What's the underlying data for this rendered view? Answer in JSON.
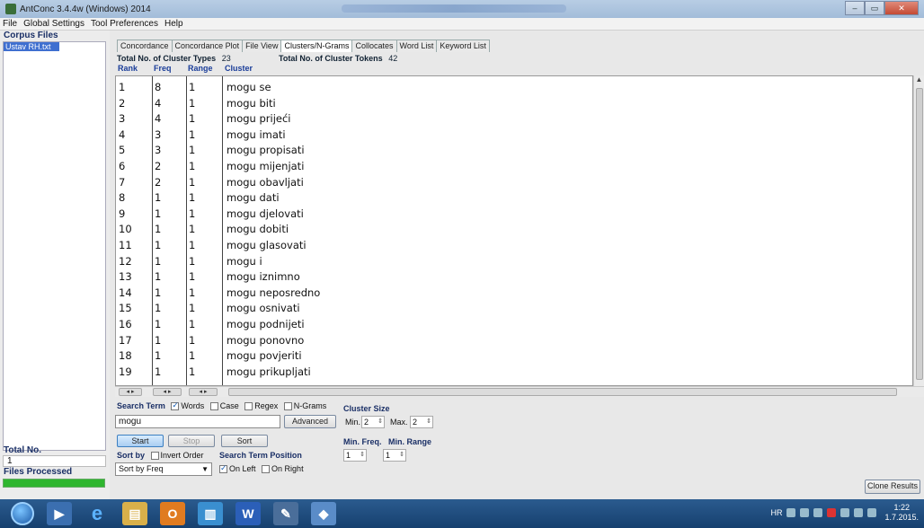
{
  "window": {
    "title": "AntConc 3.4.4w (Windows) 2014"
  },
  "menu": [
    "File",
    "Global Settings",
    "Tool Preferences",
    "Help"
  ],
  "left_panel": {
    "corpus_files_label": "Corpus Files",
    "files": [
      "Ustav RH.txt"
    ],
    "total_no_label": "Total No.",
    "total_no_value": "1",
    "files_processed_label": "Files Processed",
    "files_processed_progress": 1.0
  },
  "tabs": [
    "Concordance",
    "Concordance Plot",
    "File View",
    "Clusters/N-Grams",
    "Collocates",
    "Word List",
    "Keyword List"
  ],
  "active_tab": "Clusters/N-Grams",
  "summary": {
    "types_label": "Total No. of Cluster Types",
    "types_value": "23",
    "tokens_label": "Total No. of Cluster Tokens",
    "tokens_value": "42"
  },
  "columns": [
    "Rank",
    "Freq",
    "Range",
    "Cluster"
  ],
  "rows": [
    {
      "rank": "1",
      "freq": "8",
      "range": "1",
      "cluster": "mogu se"
    },
    {
      "rank": "2",
      "freq": "4",
      "range": "1",
      "cluster": "mogu biti"
    },
    {
      "rank": "3",
      "freq": "4",
      "range": "1",
      "cluster": "mogu prijeći"
    },
    {
      "rank": "4",
      "freq": "3",
      "range": "1",
      "cluster": "mogu imati"
    },
    {
      "rank": "5",
      "freq": "3",
      "range": "1",
      "cluster": "mogu propisati"
    },
    {
      "rank": "6",
      "freq": "2",
      "range": "1",
      "cluster": "mogu mijenjati"
    },
    {
      "rank": "7",
      "freq": "2",
      "range": "1",
      "cluster": "mogu obavljati"
    },
    {
      "rank": "8",
      "freq": "1",
      "range": "1",
      "cluster": "mogu dati"
    },
    {
      "rank": "9",
      "freq": "1",
      "range": "1",
      "cluster": "mogu djelovati"
    },
    {
      "rank": "10",
      "freq": "1",
      "range": "1",
      "cluster": "mogu dobiti"
    },
    {
      "rank": "11",
      "freq": "1",
      "range": "1",
      "cluster": "mogu glasovati"
    },
    {
      "rank": "12",
      "freq": "1",
      "range": "1",
      "cluster": "mogu i"
    },
    {
      "rank": "13",
      "freq": "1",
      "range": "1",
      "cluster": "mogu iznimno"
    },
    {
      "rank": "14",
      "freq": "1",
      "range": "1",
      "cluster": "mogu neposredno"
    },
    {
      "rank": "15",
      "freq": "1",
      "range": "1",
      "cluster": "mogu osnivati"
    },
    {
      "rank": "16",
      "freq": "1",
      "range": "1",
      "cluster": "mogu podnijeti"
    },
    {
      "rank": "17",
      "freq": "1",
      "range": "1",
      "cluster": "mogu ponovno"
    },
    {
      "rank": "18",
      "freq": "1",
      "range": "1",
      "cluster": "mogu povjeriti"
    },
    {
      "rank": "19",
      "freq": "1",
      "range": "1",
      "cluster": "mogu prikupljati"
    }
  ],
  "controls": {
    "search_term_label": "Search Term",
    "words_label": "Words",
    "case_label": "Case",
    "regex_label": "Regex",
    "ngrams_label": "N-Grams",
    "search_value": "mogu",
    "advanced_label": "Advanced",
    "start_label": "Start",
    "stop_label": "Stop",
    "sort_label": "Sort",
    "sort_by_label": "Sort by",
    "invert_order_label": "Invert Order",
    "sort_by_value": "Sort by Freq",
    "search_term_position_label": "Search Term Position",
    "on_left_label": "On Left",
    "on_right_label": "On Right",
    "cluster_size_label": "Cluster Size",
    "min_label": "Min.",
    "min_value": "2",
    "max_label": "Max.",
    "max_value": "2",
    "min_freq_label": "Min. Freq.",
    "min_freq_value": "1",
    "min_range_label": "Min. Range",
    "min_range_value": "1",
    "clone_results_label": "Clone Results"
  },
  "taskbar": {
    "lang": "HR",
    "time": "1:22",
    "date": "1.7.2015."
  }
}
